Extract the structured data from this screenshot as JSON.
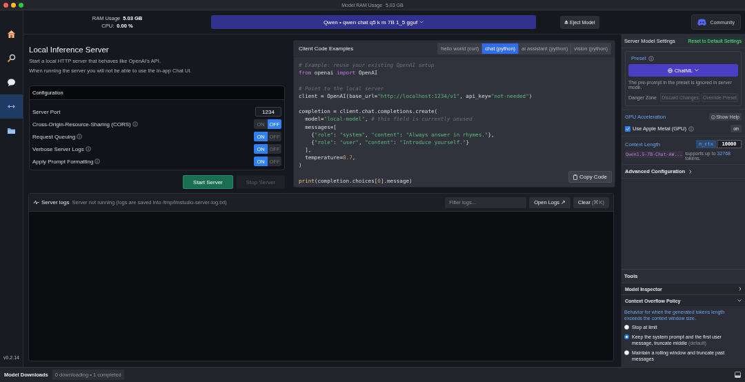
{
  "window": {
    "title": "Model RAM Usage",
    "title_value": "5.03 GB"
  },
  "sidebar": {
    "items": [
      {
        "selected": false
      },
      {
        "selected": false
      },
      {
        "selected": false
      },
      {
        "selected": true
      },
      {
        "selected": false
      }
    ],
    "version": "v0.2.14"
  },
  "header": {
    "ram_label": "RAM Usage",
    "ram_value": "5.03 GB",
    "cpu_label": "CPU:",
    "cpu_value": "0.00 %",
    "model": "Qwen • qwen chat q5 k m 7B 1_5 gguf",
    "eject": "Eject Model",
    "community": "Community"
  },
  "server": {
    "title": "Local Inference Server",
    "lines": [
      "Start a local HTTP server that behaves like OpenAI's API.",
      "When running the server you will not be able to use the in-app Chat UI."
    ],
    "config_title": "Configuration",
    "rows": [
      {
        "kind": "field",
        "label": "Server Port",
        "value": "1234",
        "info": false
      },
      {
        "kind": "toggle",
        "label": "Cross-Origin-Resource-Sharing (CORS)",
        "on": false,
        "info": true,
        "on_label": "ON",
        "off_label": "OFF"
      },
      {
        "kind": "toggle",
        "label": "Request Queuing",
        "on": true,
        "info": true,
        "on_label": "ON",
        "off_label": "OFF"
      },
      {
        "kind": "toggle",
        "label": "Verbose Server Logs",
        "on": true,
        "info": true,
        "on_label": "ON",
        "off_label": "OFF"
      },
      {
        "kind": "toggle",
        "label": "Apply Prompt Formatting",
        "on": true,
        "info": true,
        "on_label": "ON",
        "off_label": "OFF"
      }
    ],
    "start": {
      "label": "Start Server",
      "disabled": false
    },
    "stop": {
      "label": "Stop Server",
      "disabled": true
    }
  },
  "code": {
    "title": "Client Code Examples",
    "tabs": [
      {
        "label": "hello world (curl)",
        "selected": false
      },
      {
        "label": "chat (python)",
        "selected": true
      },
      {
        "label": "ai assistant (python)",
        "selected": false
      },
      {
        "label": "vision (python)",
        "selected": false
      }
    ],
    "lines": [
      {
        "gap_before": false,
        "segments": [
          {
            "kind": "comment",
            "text": "# Example: reuse your existing OpenAI setup"
          }
        ]
      },
      {
        "gap_before": false,
        "segments": [
          {
            "kind": "keyword",
            "text": "from"
          },
          {
            "kind": "plain",
            "text": " openai "
          },
          {
            "kind": "keyword",
            "text": "import"
          },
          {
            "kind": "plain",
            "text": " OpenAI"
          }
        ]
      },
      {
        "gap_before": true,
        "segments": [
          {
            "kind": "comment",
            "text": "# Point to the local server"
          }
        ]
      },
      {
        "gap_before": false,
        "segments": [
          {
            "kind": "plain",
            "text": "client = OpenAI(base_url="
          },
          {
            "kind": "string",
            "text": "\"http://localhost:1234/v1\""
          },
          {
            "kind": "plain",
            "text": ", api_key="
          },
          {
            "kind": "string",
            "text": "\"not-needed\""
          },
          {
            "kind": "plain",
            "text": ")"
          }
        ]
      },
      {
        "gap_before": true,
        "segments": [
          {
            "kind": "plain",
            "text": "completion = client.chat.completions.create("
          }
        ]
      },
      {
        "gap_before": false,
        "segments": [
          {
            "kind": "plain",
            "text": "  model="
          },
          {
            "kind": "string",
            "text": "\"local-model\""
          },
          {
            "kind": "plain",
            "text": ", "
          },
          {
            "kind": "comment",
            "text": "# this field is currently unused"
          }
        ]
      },
      {
        "gap_before": false,
        "segments": [
          {
            "kind": "plain",
            "text": "  messages=["
          }
        ]
      },
      {
        "gap_before": false,
        "segments": [
          {
            "kind": "plain",
            "text": "    {"
          },
          {
            "kind": "string",
            "text": "\"role\""
          },
          {
            "kind": "plain",
            "text": ": "
          },
          {
            "kind": "string",
            "text": "\"system\""
          },
          {
            "kind": "plain",
            "text": ", "
          },
          {
            "kind": "string",
            "text": "\"content\""
          },
          {
            "kind": "plain",
            "text": ": "
          },
          {
            "kind": "string",
            "text": "\"Always answer in rhymes.\""
          },
          {
            "kind": "plain",
            "text": "},"
          }
        ]
      },
      {
        "gap_before": false,
        "segments": [
          {
            "kind": "plain",
            "text": "    {"
          },
          {
            "kind": "string",
            "text": "\"role\""
          },
          {
            "kind": "plain",
            "text": ": "
          },
          {
            "kind": "string",
            "text": "\"user\""
          },
          {
            "kind": "plain",
            "text": ", "
          },
          {
            "kind": "string",
            "text": "\"content\""
          },
          {
            "kind": "plain",
            "text": ": "
          },
          {
            "kind": "string",
            "text": "\"Introduce yourself.\""
          },
          {
            "kind": "plain",
            "text": "}"
          }
        ]
      },
      {
        "gap_before": false,
        "segments": [
          {
            "kind": "plain",
            "text": "  ],"
          }
        ]
      },
      {
        "gap_before": false,
        "segments": [
          {
            "kind": "plain",
            "text": "  temperature="
          },
          {
            "kind": "number",
            "text": "0.7"
          },
          {
            "kind": "plain",
            "text": ","
          }
        ]
      },
      {
        "gap_before": false,
        "segments": [
          {
            "kind": "plain",
            "text": ")"
          }
        ]
      },
      {
        "gap_before": true,
        "segments": [
          {
            "kind": "func",
            "text": "print"
          },
          {
            "kind": "plain",
            "text": "(completion.choices["
          },
          {
            "kind": "number",
            "text": "0"
          },
          {
            "kind": "plain",
            "text": "].message)"
          }
        ]
      }
    ],
    "copy": "Copy Code"
  },
  "logs": {
    "title": "Server logs",
    "status": "Server not running (logs are saved into /tmp/lmstudio-server-log.txt)",
    "filter_placeholder": "Filter logs...",
    "open": "Open Logs ↗",
    "clear": "Clear",
    "clear_shortcut": "(⌘K)"
  },
  "settings": {
    "title": "Server Model Settings",
    "reset": "Reset to Default Settings",
    "preset_label": "Preset",
    "preset": "ChatML",
    "preset_note": "The pre-prompt in the preset is ignored in server mode.",
    "danger_label": "Danger Zone",
    "discard": "Discard Changes",
    "override": "Override Preset",
    "gpu_title": "GPU Acceleration",
    "show_help": "Show Help",
    "gpu_label": "Use Apple Metal (GPU)",
    "gpu_checked": true,
    "gpu_value": "on",
    "ctx_title": "Context Length",
    "ctx_key": "n_ctx",
    "ctx_value": "10000",
    "ctx_model": "Qwen1.5-7B-Chat-AW...",
    "ctx_note": "supports up to **32768** tokens.",
    "advanced": "Advanced Configuration"
  },
  "tools": {
    "title": "Tools",
    "sections": [
      {
        "label": "Model Inspector",
        "expanded": false
      },
      {
        "label": "Context Overflow Policy",
        "expanded": true
      }
    ],
    "policy_note": "Behavior for when the generated tokens length exceeds the context window size.",
    "options": [
      {
        "label": "Stop at limit",
        "selected": false
      },
      {
        "label": "Keep the system prompt and the first user message, truncate middle",
        "hint": "(default)",
        "selected": true
      },
      {
        "label": "Maintain a rolling window and truncate past messages",
        "selected": false
      }
    ]
  },
  "status_bar": {
    "label": "Model Downloads",
    "summary": "0 downloading • 1 completed"
  }
}
